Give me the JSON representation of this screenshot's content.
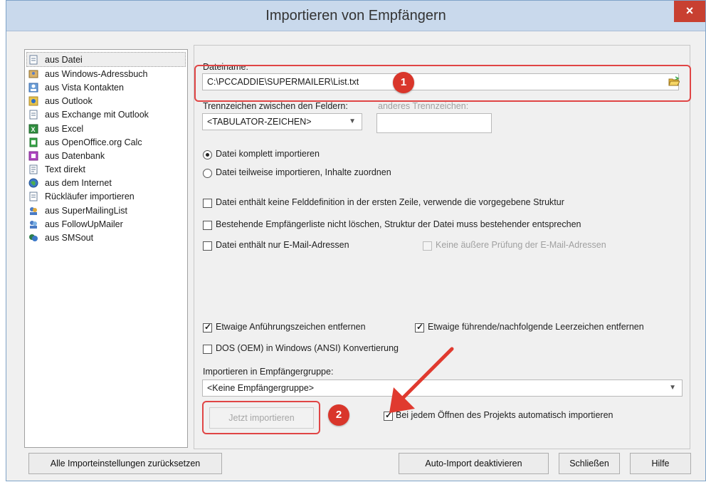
{
  "window": {
    "title": "Importieren von Empfängern",
    "close_glyph": "×"
  },
  "sources": [
    {
      "label": "aus Datei",
      "icon": "file-icon",
      "selected": true
    },
    {
      "label": "aus Windows-Adressbuch",
      "icon": "address-book-icon"
    },
    {
      "label": "aus Vista Kontakten",
      "icon": "contacts-icon"
    },
    {
      "label": "aus Outlook",
      "icon": "outlook-icon"
    },
    {
      "label": "aus Exchange mit Outlook",
      "icon": "file-icon"
    },
    {
      "label": "aus Excel",
      "icon": "excel-icon"
    },
    {
      "label": "aus OpenOffice.org Calc",
      "icon": "calc-icon"
    },
    {
      "label": "aus Datenbank",
      "icon": "database-icon"
    },
    {
      "label": "Text direkt",
      "icon": "text-icon"
    },
    {
      "label": "aus dem Internet",
      "icon": "globe-icon"
    },
    {
      "label": "Rückläufer importieren",
      "icon": "file-icon"
    },
    {
      "label": "aus SuperMailingList",
      "icon": "users-icon"
    },
    {
      "label": "aus FollowUpMailer",
      "icon": "users-icon"
    },
    {
      "label": "aus SMSout",
      "icon": "sms-icon"
    }
  ],
  "form": {
    "filename_label": "Dateiname:",
    "filename_value": "C:\\PCCADDIE\\SUPERMAILER\\List.txt",
    "separator_label": "Trennzeichen zwischen den Feldern:",
    "separator_value": "<TABULATOR-ZEICHEN>",
    "other_separator_label": "anderes Trennzeichen:",
    "other_separator_value": "",
    "radio_full": "Datei komplett importieren",
    "radio_partial": "Datei teilweise importieren, Inhalte zuordnen",
    "cb_no_fielddef": "Datei enthält keine Felddefinition in der ersten Zeile, verwende die vorgegebene Struktur",
    "cb_keep_list": "Bestehende Empfängerliste nicht löschen, Struktur der Datei muss bestehender entsprechen",
    "cb_email_only": "Datei enthält nur E-Mail-Adressen",
    "cb_no_check": "Keine äußere Prüfung der E-Mail-Adressen",
    "cb_quotes": "Etwaige Anführungszeichen entfernen",
    "cb_spaces": "Etwaige führende/nachfolgende Leerzeichen entfernen",
    "cb_dos": "DOS (OEM) in Windows (ANSI) Konvertierung",
    "group_label": "Importieren in Empfängergruppe:",
    "group_value": "<Keine Empfängergruppe>",
    "import_now": "Jetzt importieren",
    "auto_import": "Bei jedem Öffnen des Projekts automatisch importieren",
    "check_glyph": "✓"
  },
  "footer": {
    "reset": "Alle Importeinstellungen zurücksetzen",
    "deactivate": "Auto-Import deaktivieren",
    "close": "Schließen",
    "help": "Hilfe"
  },
  "annotations": {
    "badge1": "1",
    "badge2": "2"
  },
  "colors": {
    "annotation_red": "#e04545",
    "titlebar": "#c9d9ec",
    "close": "#c84031"
  }
}
